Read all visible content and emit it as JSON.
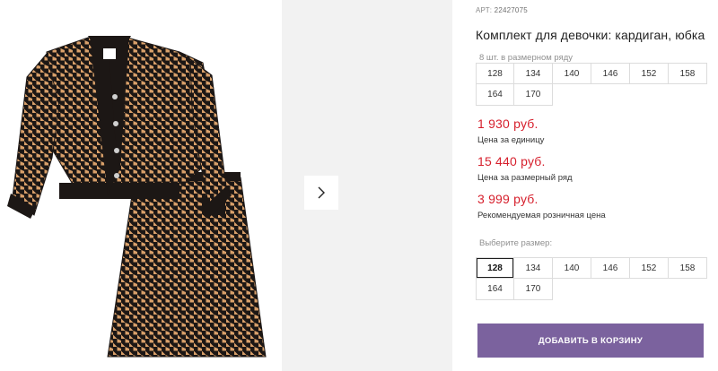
{
  "product": {
    "article_label": "АРТ:",
    "article_number": "22427075",
    "title": "Комплект для девочки: кардиган, юбка",
    "set_caption": "8 шт. в размерном ряду",
    "set_sizes": [
      "128",
      "134",
      "140",
      "146",
      "152",
      "158",
      "164",
      "170"
    ],
    "prices": [
      {
        "amount": "1 930 руб.",
        "label": "Цена за единицу"
      },
      {
        "amount": "15 440 руб.",
        "label": "Цена за размерный ряд"
      },
      {
        "amount": "3 999 руб.",
        "label": "Рекомендуемая розничная цена"
      }
    ],
    "choose_size_label": "Выберите размер:",
    "size_options": [
      "128",
      "134",
      "140",
      "146",
      "152",
      "158",
      "164",
      "170"
    ],
    "selected_size": "128",
    "add_to_cart_label": "ДОБАВИТЬ В КОРЗИНУ"
  },
  "gallery": {
    "next_icon": "chevron-right-icon",
    "image_subject": "houndstooth-cardigan-and-skirt"
  },
  "colors": {
    "price": "#d61f2c",
    "button": "#7b629e",
    "houndstooth_light": "#d9a06a",
    "houndstooth_dark": "#1c1715"
  }
}
